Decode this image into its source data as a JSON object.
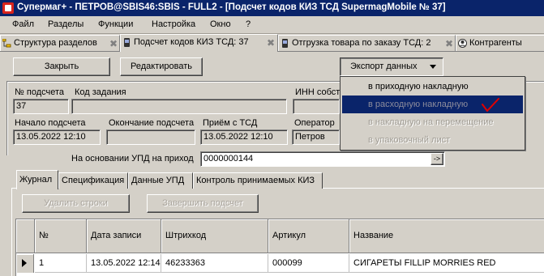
{
  "window": {
    "title": "Супермаг+ - ПЕТРОВ@SBIS46:SBIS - FULL2 - [Подсчет кодов КИЗ ТСД SupermagMobile № 37]"
  },
  "menu": [
    "Файл",
    "Разделы",
    "Функции",
    "Настройка",
    "Окно",
    "?"
  ],
  "doc_tabs": [
    {
      "label": "Структура разделов"
    },
    {
      "label": "Подсчет кодов КИЗ ТСД: 37"
    },
    {
      "label": "Отгрузка товара по заказу ТСД: 2"
    },
    {
      "label": "Контрагенты"
    }
  ],
  "toolbar": {
    "close": "Закрыть",
    "edit": "Редактировать",
    "export": "Экспорт данных"
  },
  "export_menu": [
    "в приходную накладную",
    "в расходную накладную",
    "в накладную на перемещение",
    "в упаковочный лист"
  ],
  "form": {
    "count_no_label": "№ подсчета",
    "count_no": "37",
    "task_code_label": "Код задания",
    "inn_label": "ИНН собст",
    "start_label": "Начало подсчета",
    "start": "13.05.2022 12:10",
    "end_label": "Окончание подсчета",
    "received_label": "Приём с ТСД",
    "received": "13.05.2022 12:10",
    "operator_label": "Оператор",
    "operator": "Петров",
    "upd_label": "На основании УПД на приход",
    "upd": "0000000144",
    "upd_button": "->"
  },
  "inner_tabs": [
    "Журнал",
    "Спецификация",
    "Данные УПД",
    "Контроль принимаемых КИЗ"
  ],
  "journal": {
    "delete_rows": "Удалить строки",
    "finish_count": "Завершить подсчет",
    "columns": [
      "№",
      "Дата записи",
      "Штрихкод",
      "Артикул",
      "Название"
    ],
    "rows": [
      [
        "1",
        "13.05.2022 12:14",
        "46233363",
        "000099",
        "СИГАРЕТЫ FILLIP MORRIES RED"
      ]
    ]
  },
  "colors": {
    "titlebar": "#0a246a",
    "selection": "#0a246a",
    "checkmark": "#e00000",
    "window_bg": "#d4d0c8"
  }
}
